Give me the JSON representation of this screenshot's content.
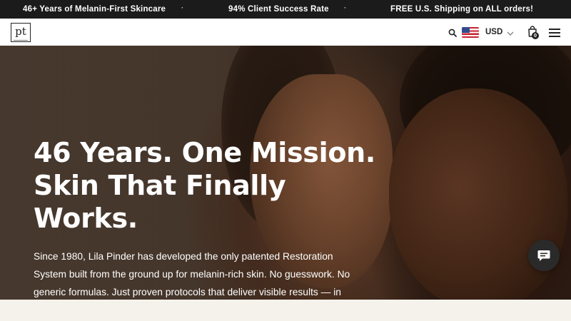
{
  "announcement": {
    "messages": [
      "46+ Years of Melanin-First Skincare",
      "94% Client Success Rate",
      "FREE U.S. Shipping on ALL orders!"
    ],
    "separator": "·"
  },
  "header": {
    "logo_text": "pt",
    "currency": "USD",
    "cart_count": "0",
    "icons": [
      "search-icon",
      "us-flag-icon",
      "chevron-down-icon",
      "shopping-bag-icon",
      "hamburger-menu-icon"
    ]
  },
  "hero": {
    "title_lines": [
      "46 Years. One Mission.",
      "Skin That Finally",
      "Works."
    ],
    "body_lines": [
      "Since 1980, Lila Pinder has developed the only patented Restoration",
      "System built from the ground up for melanin-rich skin. No guesswork. No",
      "generic formulas. Just proven protocols that deliver visible results — in"
    ]
  },
  "chat": {
    "icon": "chat-bubble-icon"
  },
  "colors": {
    "announcement_bg": "#1b1b1b",
    "header_bg": "#ffffff",
    "hero_text": "#ffffff",
    "page_bg": "#f5f2ec"
  }
}
